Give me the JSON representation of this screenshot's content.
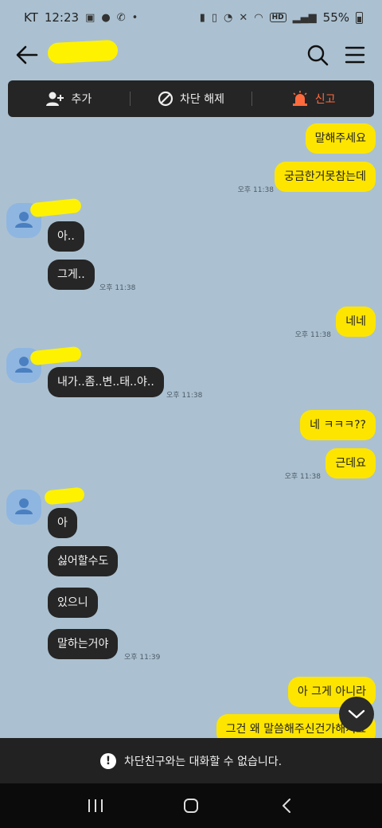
{
  "status_bar": {
    "carrier": "KT",
    "time": "12:23",
    "battery": "55%"
  },
  "header": {
    "chat_name": "",
    "back_icon": "arrow-left-icon",
    "search_icon": "search-icon",
    "menu_icon": "hamburger-menu-icon"
  },
  "action_bar": {
    "add_label": "추가",
    "unblock_label": "차단 해제",
    "report_label": "신고",
    "report_color": "#ff6a3d"
  },
  "messages": [
    {
      "from": "me",
      "text": "말해주세요"
    },
    {
      "from": "me",
      "text": "궁금한거못참는데",
      "time": "오후 11:38"
    },
    {
      "from": "them",
      "text": "아.."
    },
    {
      "from": "them",
      "text": "그게..",
      "time": "오후 11:38"
    },
    {
      "from": "me",
      "text": "네네",
      "time": "오후 11:38"
    },
    {
      "from": "them",
      "text": "내가..좀..변..태..야..",
      "time": "오후 11:38"
    },
    {
      "from": "me",
      "text": "네 ㅋㅋㅋ??"
    },
    {
      "from": "me",
      "text": "근데요",
      "time": "오후 11:38"
    },
    {
      "from": "them",
      "text": "아"
    },
    {
      "from": "them",
      "text": "싫어할수도"
    },
    {
      "from": "them",
      "text": "있으니"
    },
    {
      "from": "them",
      "text": "말하는거야",
      "time": "오후 11:39"
    },
    {
      "from": "me",
      "text": "아 그게 아니라"
    },
    {
      "from": "me",
      "text": "그건 왜 말씀해주신건가해서요"
    }
  ],
  "blocked_notice": "차단친구와는 대화할 수 없습니다.",
  "colors": {
    "background": "#abc1d1",
    "my_bubble": "#fee500",
    "their_bubble": "#262626"
  }
}
